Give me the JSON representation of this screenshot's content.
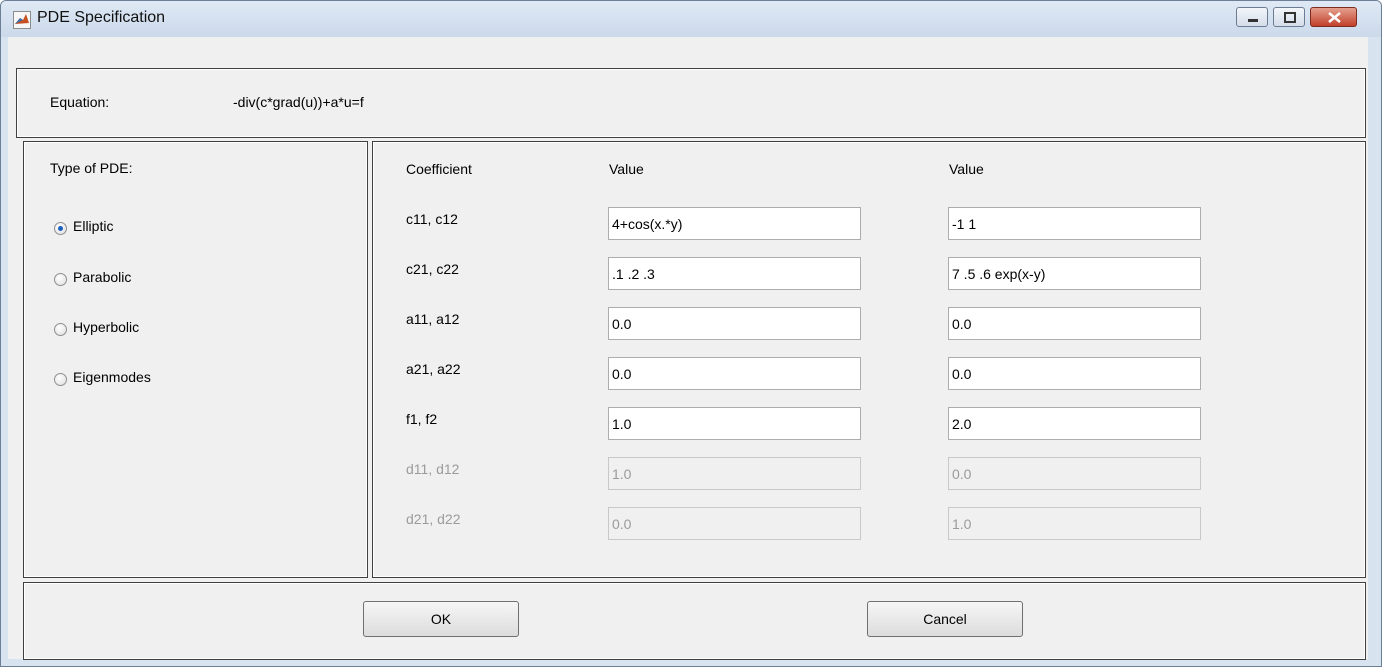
{
  "window": {
    "title": "PDE Specification",
    "controls": {
      "minimize_icon": "minimize-icon",
      "maximize_icon": "maximize-icon",
      "close_icon": "close-icon"
    }
  },
  "equation": {
    "label": "Equation:",
    "value": "-div(c*grad(u))+a*u=f"
  },
  "type_panel": {
    "heading": "Type of PDE:",
    "options": [
      {
        "label": "Elliptic",
        "selected": true
      },
      {
        "label": "Parabolic",
        "selected": false
      },
      {
        "label": "Hyperbolic",
        "selected": false
      },
      {
        "label": "Eigenmodes",
        "selected": false
      }
    ]
  },
  "coefficients": {
    "headers": [
      "Coefficient",
      "Value",
      "Value"
    ],
    "rows": [
      {
        "name": "c11, c12",
        "v1": "4+cos(x.*y)",
        "v2": "-1 1",
        "enabled": true
      },
      {
        "name": "c21, c22",
        "v1": ".1 .2 .3",
        "v2": "7 .5 .6 exp(x-y)",
        "enabled": true
      },
      {
        "name": "a11, a12",
        "v1": "0.0",
        "v2": "0.0",
        "enabled": true
      },
      {
        "name": "a21, a22",
        "v1": "0.0",
        "v2": "0.0",
        "enabled": true
      },
      {
        "name": "f1, f2",
        "v1": "1.0",
        "v2": "2.0",
        "enabled": true
      },
      {
        "name": "d11, d12",
        "v1": "1.0",
        "v2": "0.0",
        "enabled": false
      },
      {
        "name": "d21, d22",
        "v1": "0.0",
        "v2": "1.0",
        "enabled": false
      }
    ]
  },
  "buttons": {
    "ok": "OK",
    "cancel": "Cancel"
  },
  "colors": {
    "radio_selected": "#1b5fbf",
    "disabled_text": "#9b9b9b",
    "close_button": "#c1402b"
  }
}
